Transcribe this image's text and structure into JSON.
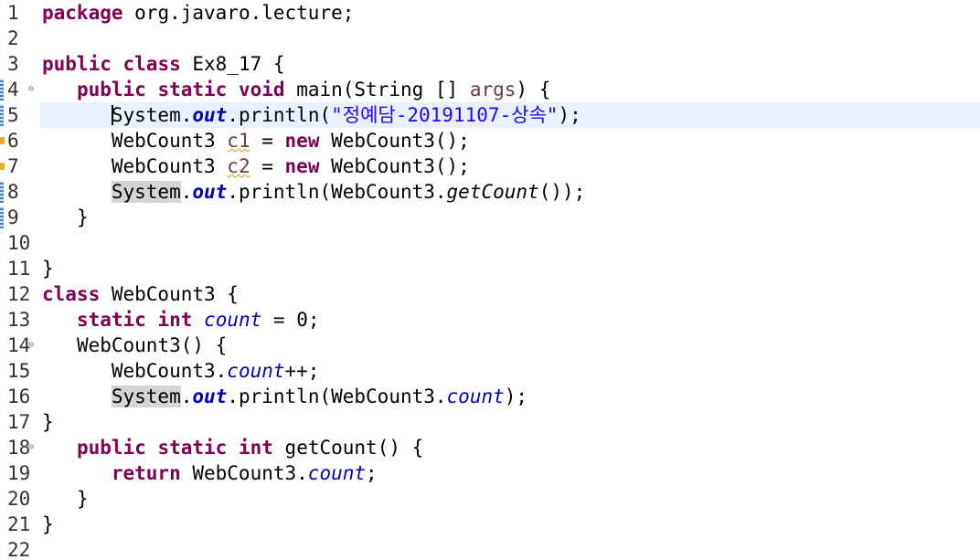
{
  "editor": {
    "lines": [
      {
        "num": "1",
        "fold": "",
        "marker": "",
        "indent": "",
        "tokens": [
          {
            "t": "package",
            "c": "kw"
          },
          {
            "t": " org.javaro.lecture;",
            "c": ""
          }
        ]
      },
      {
        "num": "2",
        "fold": "",
        "marker": "",
        "indent": "",
        "tokens": []
      },
      {
        "num": "3",
        "fold": "",
        "marker": "",
        "indent": "",
        "tokens": [
          {
            "t": "public",
            "c": "kw"
          },
          {
            "t": " ",
            "c": ""
          },
          {
            "t": "class",
            "c": "kw"
          },
          {
            "t": " Ex8_17 {",
            "c": ""
          }
        ]
      },
      {
        "num": "4",
        "fold": "⊖",
        "marker": "bar",
        "indent": "   ",
        "tokens": [
          {
            "t": "public",
            "c": "kw"
          },
          {
            "t": " ",
            "c": ""
          },
          {
            "t": "static",
            "c": "kw"
          },
          {
            "t": " ",
            "c": ""
          },
          {
            "t": "void",
            "c": "kw"
          },
          {
            "t": " main(String [] ",
            "c": ""
          },
          {
            "t": "args",
            "c": "param"
          },
          {
            "t": ") {",
            "c": ""
          }
        ]
      },
      {
        "num": "5",
        "fold": "",
        "marker": "bar",
        "indent": "      ",
        "current": true,
        "caret": true,
        "tokens": [
          {
            "t": "System",
            "c": ""
          },
          {
            "t": ".",
            "c": ""
          },
          {
            "t": "out",
            "c": "fld-static"
          },
          {
            "t": ".println(",
            "c": ""
          },
          {
            "t": "\"정예담-20191107-상속\"",
            "c": "str"
          },
          {
            "t": ");",
            "c": ""
          }
        ]
      },
      {
        "num": "6",
        "fold": "",
        "marker": "warn",
        "indent": "      ",
        "tokens": [
          {
            "t": "WebCount3 ",
            "c": ""
          },
          {
            "t": "c1",
            "c": "local"
          },
          {
            "t": " = ",
            "c": ""
          },
          {
            "t": "new",
            "c": "kw"
          },
          {
            "t": " WebCount3();",
            "c": ""
          }
        ]
      },
      {
        "num": "7",
        "fold": "",
        "marker": "warn",
        "indent": "      ",
        "tokens": [
          {
            "t": "WebCount3 ",
            "c": ""
          },
          {
            "t": "c2",
            "c": "local"
          },
          {
            "t": " = ",
            "c": ""
          },
          {
            "t": "new",
            "c": "kw"
          },
          {
            "t": " WebCount3();",
            "c": ""
          }
        ]
      },
      {
        "num": "8",
        "fold": "",
        "marker": "bar",
        "indent": "      ",
        "tokens": [
          {
            "t": "System",
            "c": "occ"
          },
          {
            "t": ".",
            "c": ""
          },
          {
            "t": "out",
            "c": "fld-static"
          },
          {
            "t": ".println(WebCount3.",
            "c": ""
          },
          {
            "t": "getCount",
            "c": "meth-italic"
          },
          {
            "t": "());",
            "c": ""
          }
        ]
      },
      {
        "num": "9",
        "fold": "",
        "marker": "bar",
        "indent": "   ",
        "tokens": [
          {
            "t": "}",
            "c": ""
          }
        ]
      },
      {
        "num": "10",
        "fold": "",
        "marker": "",
        "indent": "",
        "tokens": []
      },
      {
        "num": "11",
        "fold": "",
        "marker": "",
        "indent": "",
        "tokens": [
          {
            "t": "}",
            "c": ""
          }
        ]
      },
      {
        "num": "12",
        "fold": "",
        "marker": "",
        "indent": "",
        "tokens": [
          {
            "t": "class",
            "c": "kw"
          },
          {
            "t": " WebCount3 {",
            "c": ""
          }
        ]
      },
      {
        "num": "13",
        "fold": "",
        "marker": "",
        "indent": "   ",
        "tokens": [
          {
            "t": "static",
            "c": "kw"
          },
          {
            "t": " ",
            "c": ""
          },
          {
            "t": "int",
            "c": "kw"
          },
          {
            "t": " ",
            "c": ""
          },
          {
            "t": "count",
            "c": "fld-italic"
          },
          {
            "t": " = 0;",
            "c": ""
          }
        ]
      },
      {
        "num": "14",
        "fold": "⊖",
        "marker": "",
        "indent": "   ",
        "tokens": [
          {
            "t": "WebCount3() {",
            "c": ""
          }
        ]
      },
      {
        "num": "15",
        "fold": "",
        "marker": "",
        "indent": "      ",
        "tokens": [
          {
            "t": "WebCount3.",
            "c": ""
          },
          {
            "t": "count",
            "c": "fld-italic"
          },
          {
            "t": "++;",
            "c": ""
          }
        ]
      },
      {
        "num": "16",
        "fold": "",
        "marker": "",
        "indent": "      ",
        "tokens": [
          {
            "t": "System",
            "c": "occ"
          },
          {
            "t": ".",
            "c": ""
          },
          {
            "t": "out",
            "c": "fld-static"
          },
          {
            "t": ".println(WebCount3.",
            "c": ""
          },
          {
            "t": "count",
            "c": "fld-italic"
          },
          {
            "t": ");",
            "c": ""
          }
        ]
      },
      {
        "num": "17",
        "fold": "",
        "marker": "",
        "indent": "",
        "tokens": [
          {
            "t": "}",
            "c": ""
          }
        ]
      },
      {
        "num": "18",
        "fold": "⊖",
        "marker": "",
        "indent": "   ",
        "tokens": [
          {
            "t": "public",
            "c": "kw"
          },
          {
            "t": " ",
            "c": ""
          },
          {
            "t": "static",
            "c": "kw"
          },
          {
            "t": " ",
            "c": ""
          },
          {
            "t": "int",
            "c": "kw"
          },
          {
            "t": " getCount() {",
            "c": ""
          }
        ]
      },
      {
        "num": "19",
        "fold": "",
        "marker": "",
        "indent": "      ",
        "tokens": [
          {
            "t": "return",
            "c": "kw"
          },
          {
            "t": " WebCount3.",
            "c": ""
          },
          {
            "t": "count",
            "c": "fld-italic"
          },
          {
            "t": ";",
            "c": ""
          }
        ]
      },
      {
        "num": "20",
        "fold": "",
        "marker": "",
        "indent": "   ",
        "tokens": [
          {
            "t": "}",
            "c": ""
          }
        ]
      },
      {
        "num": "21",
        "fold": "",
        "marker": "",
        "indent": "",
        "tokens": [
          {
            "t": "}",
            "c": ""
          }
        ]
      },
      {
        "num": "22",
        "fold": "",
        "marker": "",
        "indent": "",
        "tokens": []
      }
    ]
  }
}
